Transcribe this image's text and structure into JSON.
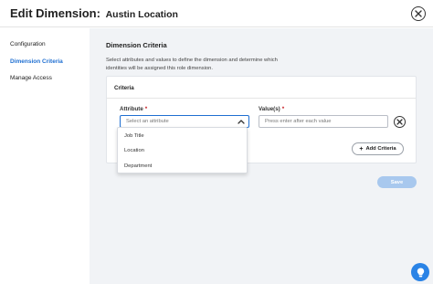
{
  "header": {
    "title": "Edit Dimension:",
    "subtitle": "Austin Location",
    "close_icon": "close-circle-icon"
  },
  "sidebar": {
    "items": [
      {
        "label": "Configuration",
        "active": false
      },
      {
        "label": "Dimension Criteria",
        "active": true
      },
      {
        "label": "Manage Access",
        "active": false
      }
    ]
  },
  "main": {
    "section_title": "Dimension Criteria",
    "description": "Select attributes and values to define the dimension and determine which identities will be assigned this role dimension.",
    "criteria": {
      "title": "Criteria",
      "attribute_label": "Attribute",
      "value_label": "Value(s)",
      "required_mark": "*",
      "attribute_placeholder": "Select an attribute",
      "value_placeholder": "Press enter after each value",
      "add_label": "Add Criteria",
      "dropdown_options": [
        "Job Title",
        "Location",
        "Department"
      ]
    },
    "save_label": "Save"
  },
  "colors": {
    "accent": "#1f6fd1",
    "save_disabled": "#a8c8ee",
    "required": "#c4161c",
    "fab": "#2a83e6",
    "panel_bg": "#f1f3f6"
  },
  "icons": {
    "remove": "close-circle-icon",
    "chevron": "chevron-up-icon",
    "add": "plus-icon",
    "help": "lightbulb-icon"
  }
}
